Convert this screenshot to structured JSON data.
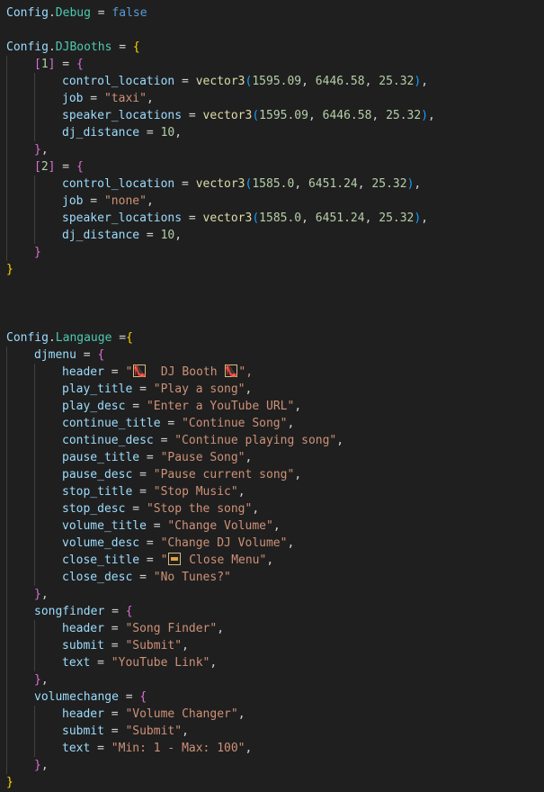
{
  "config_debug": {
    "object": "Config",
    "key": "Debug",
    "value": "false"
  },
  "djbooths": {
    "object": "Config",
    "key": "DJBooths",
    "entries": [
      {
        "index": "1",
        "control_location": [
          "1595.09",
          "6446.58",
          "25.32"
        ],
        "job": "\"taxi\"",
        "speaker_locations": [
          "1595.09",
          "6446.58",
          "25.32"
        ],
        "dj_distance": "10"
      },
      {
        "index": "2",
        "control_location": [
          "1585.0",
          "6451.24",
          "25.32"
        ],
        "job": "\"none\"",
        "speaker_locations": [
          "1585.0",
          "6451.24",
          "25.32"
        ],
        "dj_distance": "10"
      }
    ],
    "fields": {
      "control_location": "control_location",
      "job": "job",
      "speaker_locations": "speaker_locations",
      "dj_distance": "dj_distance",
      "func": "vector3"
    }
  },
  "language": {
    "object": "Config",
    "key": "Langauge",
    "djmenu": {
      "name": "djmenu",
      "header_key": "header",
      "header_pre": "\"",
      "header_text": "  DJ Booth ",
      "header_post": "\",",
      "rows": [
        {
          "key": "play_title",
          "value": "\"Play a song\""
        },
        {
          "key": "play_desc",
          "value": "\"Enter a YouTube URL\""
        },
        {
          "key": "continue_title",
          "value": "\"Continue Song\""
        },
        {
          "key": "continue_desc",
          "value": "\"Continue playing song\""
        },
        {
          "key": "pause_title",
          "value": "\"Pause Song\""
        },
        {
          "key": "pause_desc",
          "value": "\"Pause current song\""
        },
        {
          "key": "stop_title",
          "value": "\"Stop Music\""
        },
        {
          "key": "stop_desc",
          "value": "\"Stop the song\""
        },
        {
          "key": "volume_title",
          "value": "\"Change Volume\""
        },
        {
          "key": "volume_desc",
          "value": "\"Change DJ Volume\""
        }
      ],
      "close_title_key": "close_title",
      "close_title_pre": "\"",
      "close_title_text": " Close Menu\"",
      "close_desc_key": "close_desc",
      "close_desc_value": "\"No Tunes?\""
    },
    "songfinder": {
      "name": "songfinder",
      "rows": [
        {
          "key": "header",
          "value": "\"Song Finder\""
        },
        {
          "key": "submit",
          "value": "\"Submit\""
        },
        {
          "key": "text",
          "value": "\"YouTube Link\""
        }
      ]
    },
    "volumechange": {
      "name": "volumechange",
      "rows": [
        {
          "key": "header",
          "value": "\"Volume Changer\""
        },
        {
          "key": "submit",
          "value": "\"Submit\""
        },
        {
          "key": "text",
          "value": "\"Min: 1 - Max: 100\""
        }
      ]
    }
  },
  "icons": {
    "header_icon": "high-heel-icon",
    "close_icon": "door-icon"
  },
  "colors": {
    "background": "#1f1f1f",
    "variable": "#9cdcfe",
    "module": "#4ec9b0",
    "string": "#ce9178",
    "keyword": "#569cd6",
    "number": "#b5cea8",
    "function": "#dcdcaa"
  }
}
